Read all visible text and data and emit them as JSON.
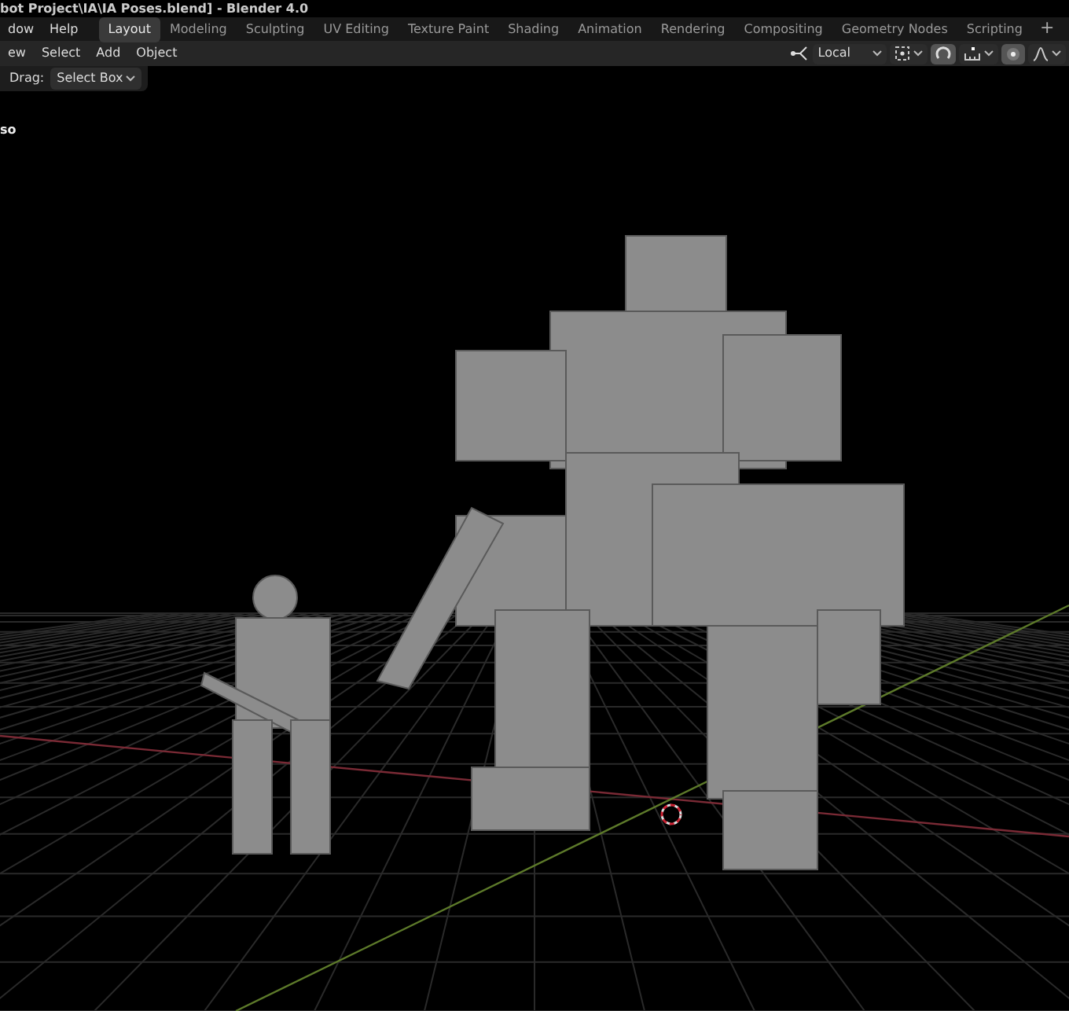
{
  "window": {
    "title": "bot Project\\IA\\IA Poses.blend] - Blender 4.0"
  },
  "menu": [
    "dow",
    "Help"
  ],
  "workspace_tabs": [
    {
      "label": "Layout",
      "selected": true
    },
    {
      "label": "Modeling",
      "selected": false
    },
    {
      "label": "Sculpting",
      "selected": false
    },
    {
      "label": "UV Editing",
      "selected": false
    },
    {
      "label": "Texture Paint",
      "selected": false
    },
    {
      "label": "Shading",
      "selected": false
    },
    {
      "label": "Animation",
      "selected": false
    },
    {
      "label": "Rendering",
      "selected": false
    },
    {
      "label": "Compositing",
      "selected": false
    },
    {
      "label": "Geometry Nodes",
      "selected": false
    },
    {
      "label": "Scripting",
      "selected": false
    }
  ],
  "add_tab": "+",
  "header_menu": [
    "ew",
    "Select",
    "Add",
    "Object"
  ],
  "transform_orientation": "Local",
  "snap": {
    "on": true
  },
  "proportional_editing": {
    "on": true
  },
  "tool_settings": {
    "drag_label": "Drag:",
    "drag_value": "Select Box"
  },
  "viewport": {
    "overlay_text": "so"
  }
}
